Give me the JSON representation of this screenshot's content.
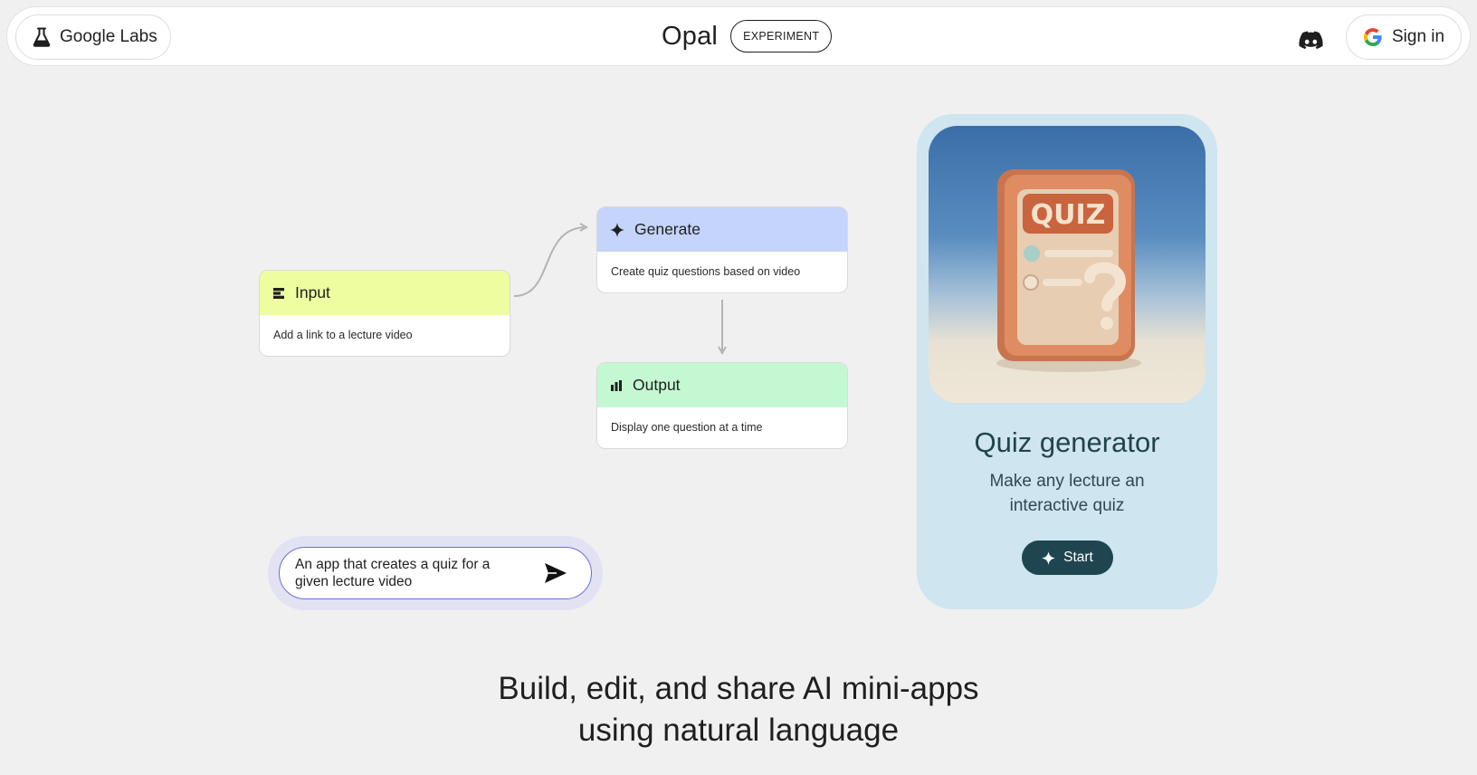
{
  "header": {
    "labs_label": "Google Labs",
    "brand_name": "Opal",
    "badge": "EXPERIMENT",
    "signin_label": "Sign in"
  },
  "flow": {
    "input": {
      "title": "Input",
      "description": "Add a link to a lecture video",
      "icon": "input-icon",
      "color": "#eefd9f"
    },
    "generate": {
      "title": "Generate",
      "description": "Create quiz questions based on video",
      "icon": "sparkle-icon",
      "color": "#c4d4fb"
    },
    "output": {
      "title": "Output",
      "description": "Display one question at a time",
      "icon": "output-icon",
      "color": "#c4f8d2"
    }
  },
  "prompt": {
    "text": "An app that creates a quiz for a given lecture video"
  },
  "quiz_card": {
    "image_label": "QUIZ",
    "title": "Quiz generator",
    "subtitle": "Make any lecture an interactive quiz",
    "start_label": "Start"
  },
  "tagline": {
    "line1": "Build, edit, and share AI mini-apps",
    "line2": "using natural language"
  },
  "colors": {
    "background": "#f0f0f0",
    "quiz_card": "#cfe5ef",
    "start_button": "#1f4650",
    "prompt_border": "#6a6fd8"
  }
}
